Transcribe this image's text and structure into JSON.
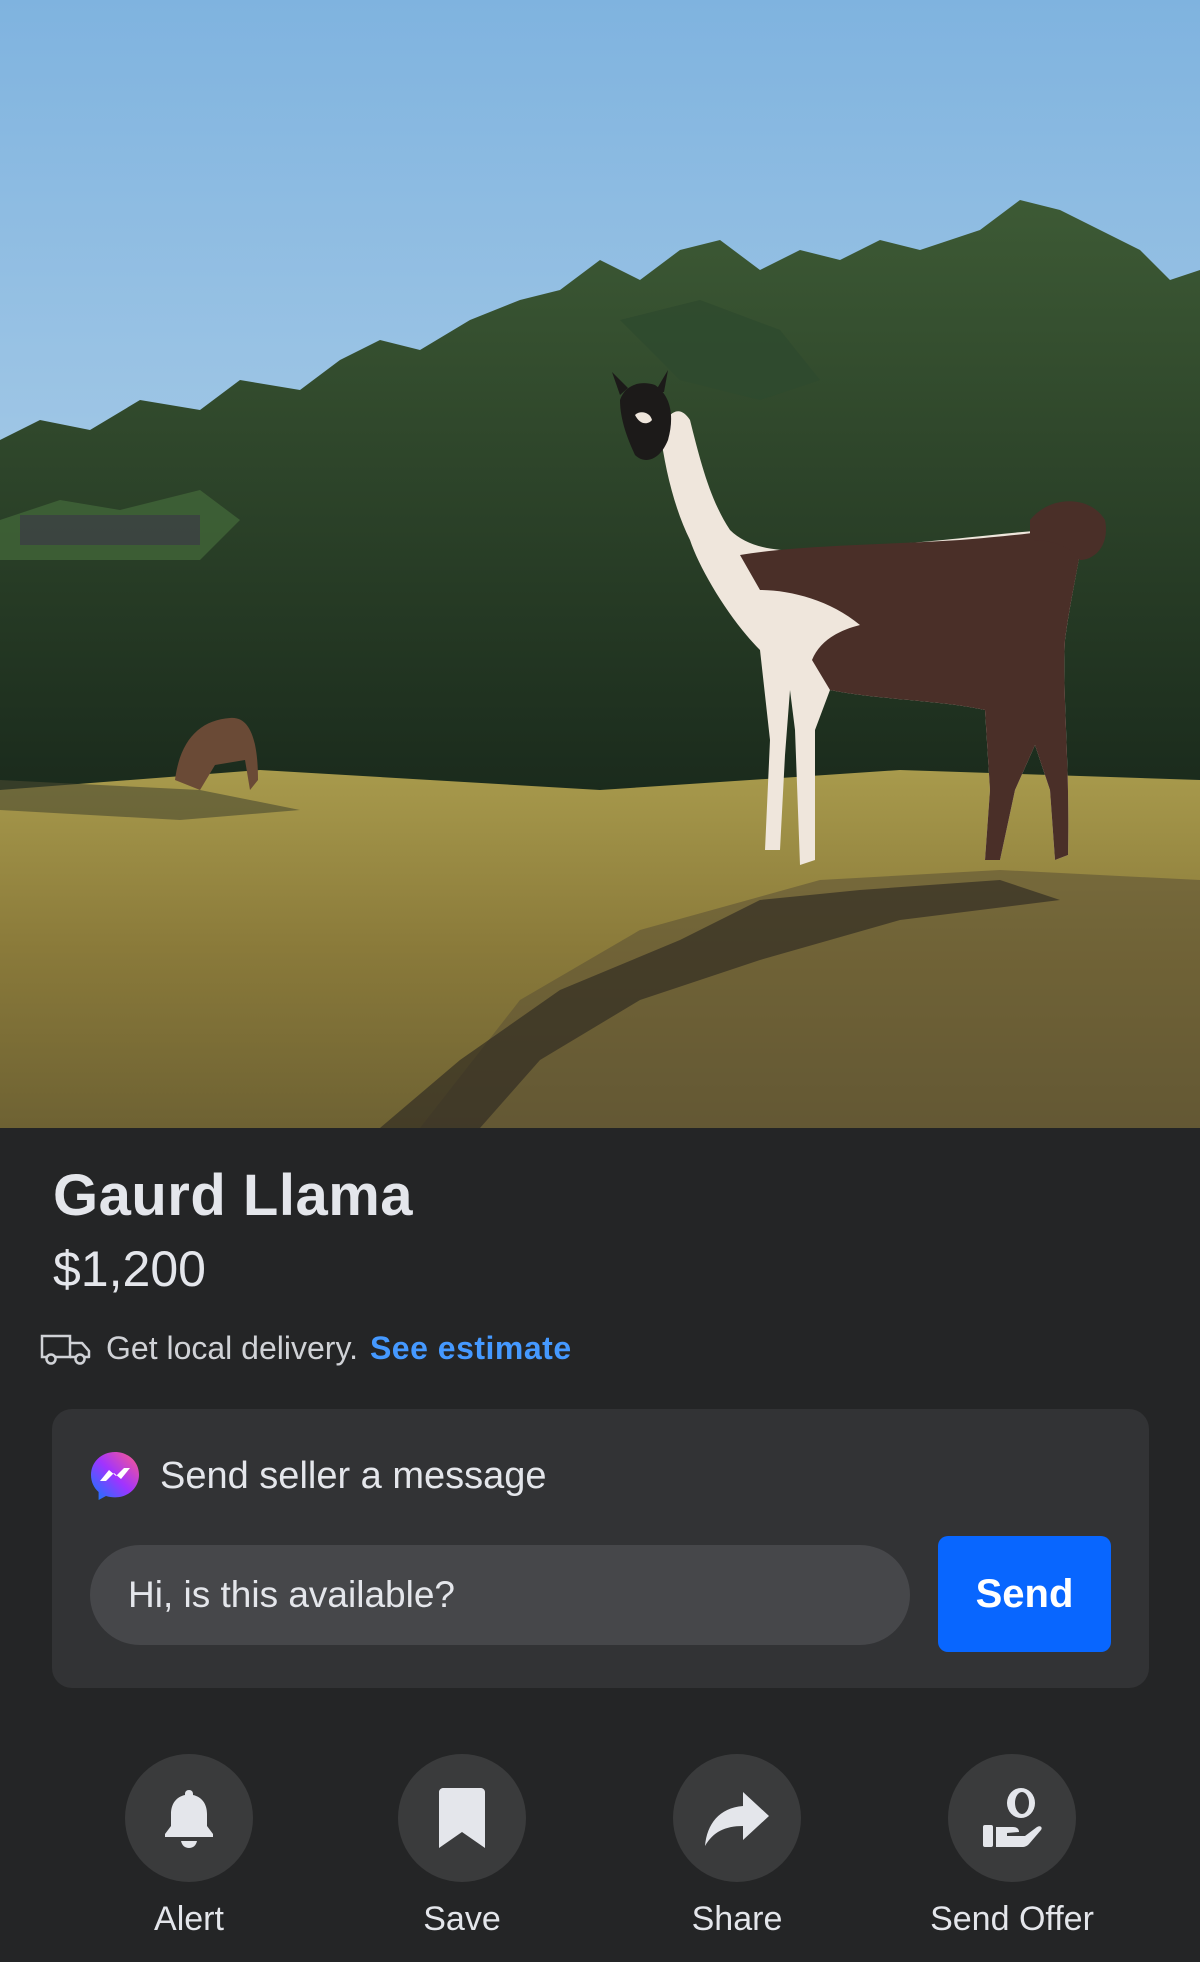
{
  "listing": {
    "title": "Gaurd Llama",
    "price": "$1,200"
  },
  "delivery": {
    "icon": "truck-icon",
    "text": "Get local delivery.",
    "link": "See estimate",
    "link_color": "#4599ff"
  },
  "message": {
    "icon": "messenger-icon",
    "heading": "Send seller a message",
    "input_value": "Hi, is this available?",
    "send_label": "Send",
    "send_color": "#0866ff"
  },
  "actions": [
    {
      "icon": "bell-icon",
      "label": "Alert"
    },
    {
      "icon": "bookmark-icon",
      "label": "Save"
    },
    {
      "icon": "share-arrow-icon",
      "label": "Share"
    },
    {
      "icon": "offer-hand-icon",
      "label": "Send Offer"
    }
  ]
}
